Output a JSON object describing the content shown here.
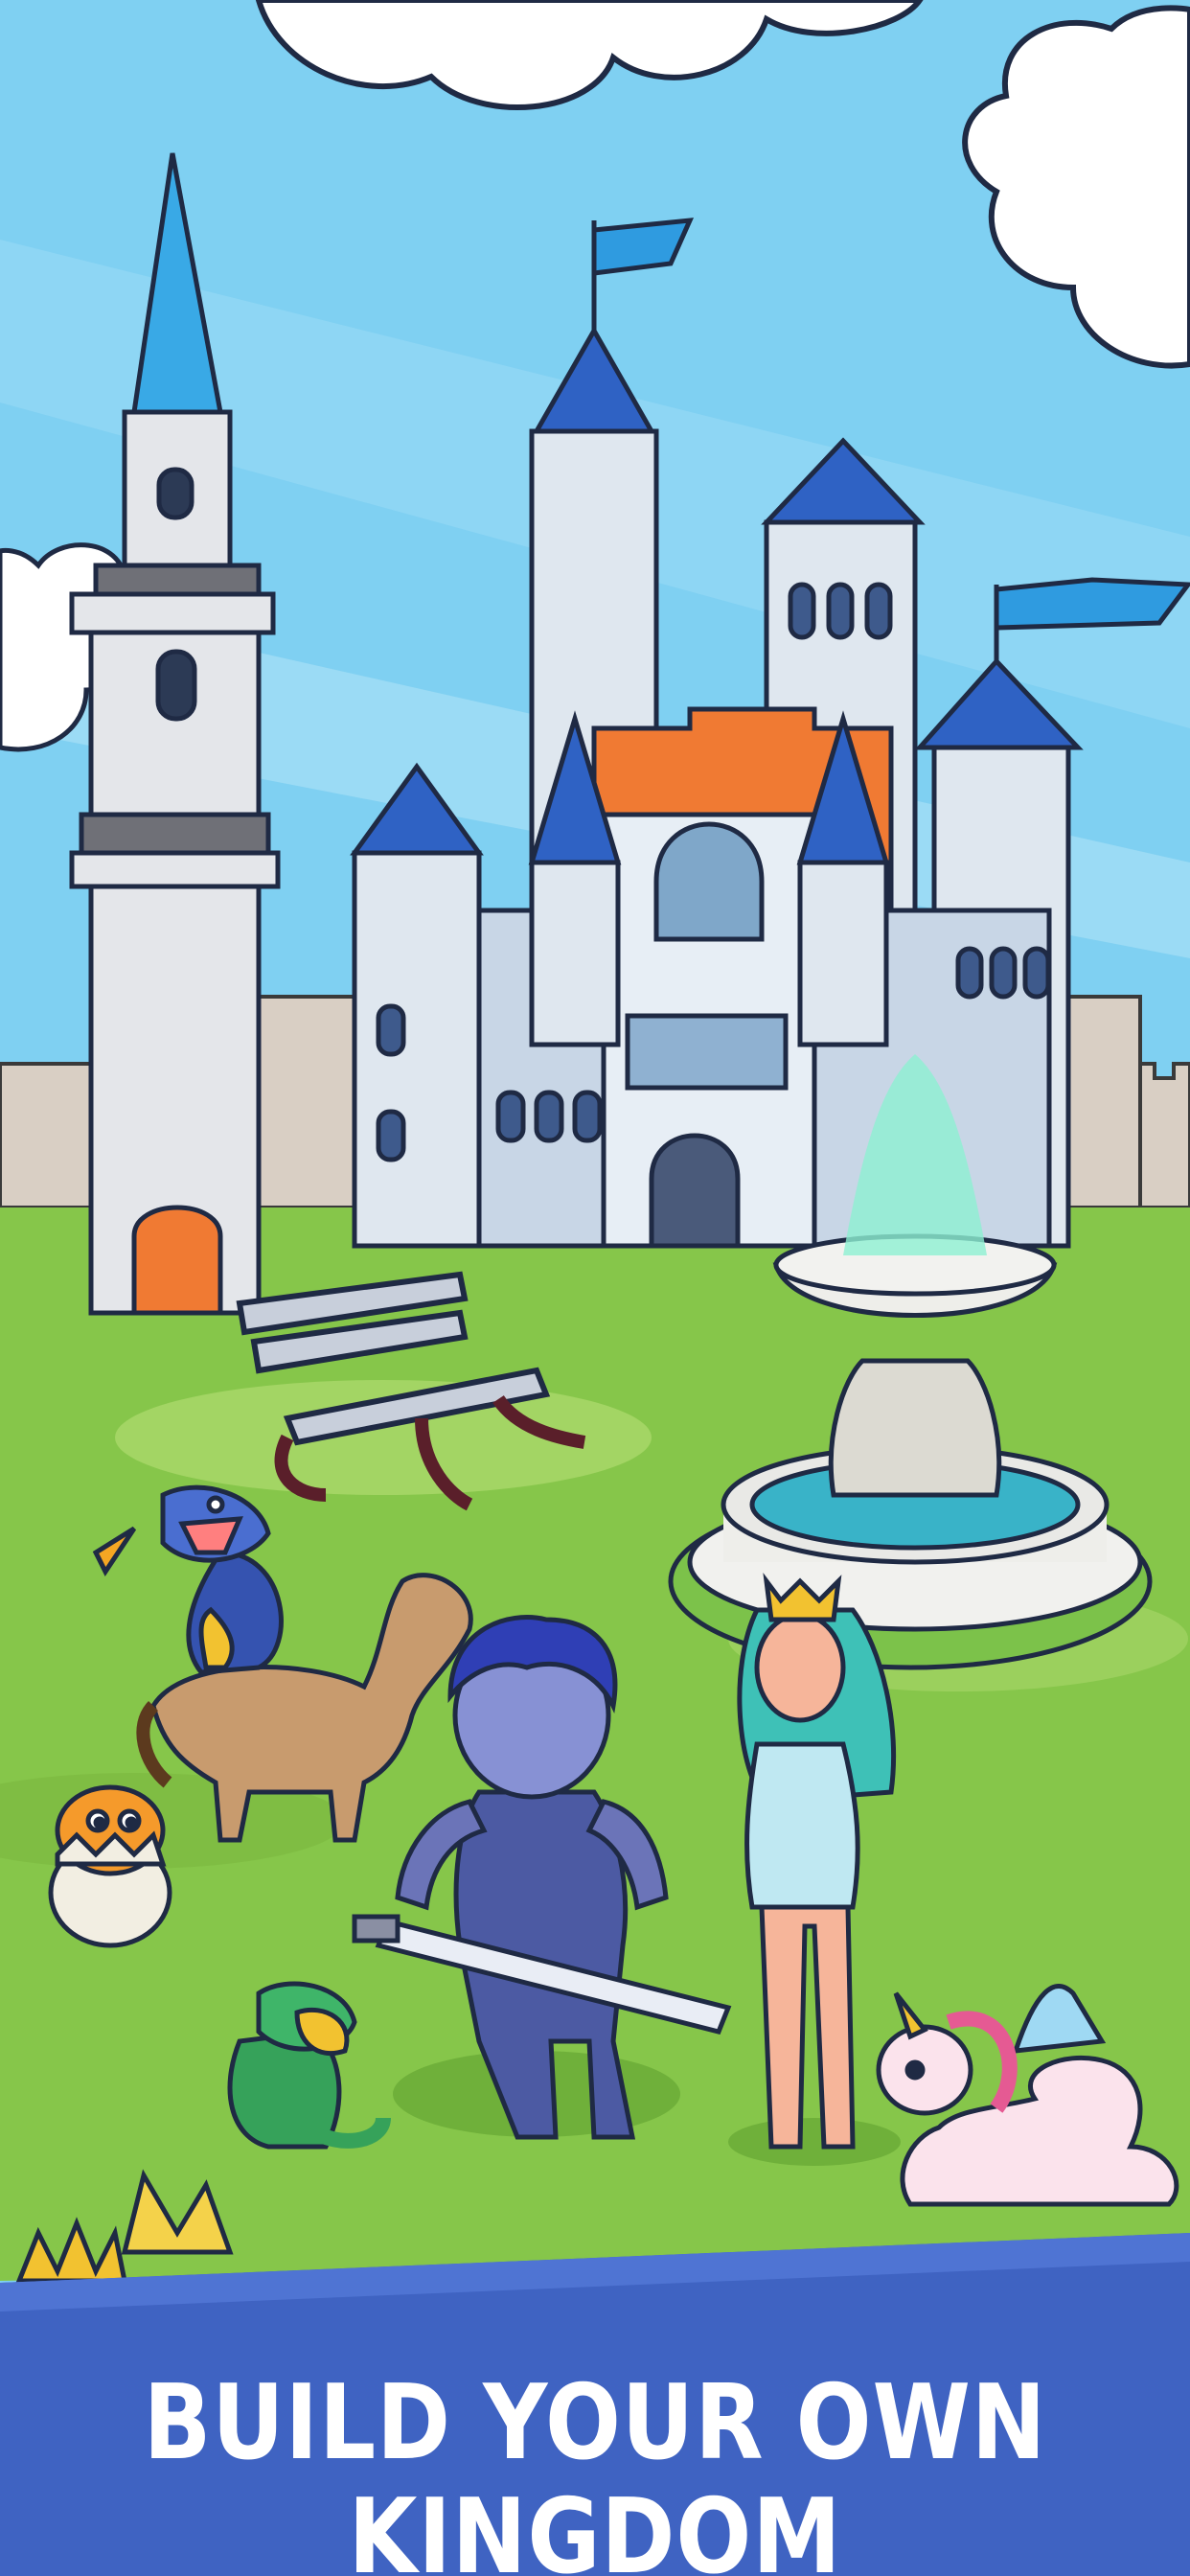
{
  "headline": "BUILD YOUR OWN KINGDOM",
  "colors": {
    "sky": "#7fd0f2",
    "grass": "#86c64a",
    "castle_stone": "#e3ebf2",
    "roof_blue": "#2f62c4",
    "banner_blue": "#3f63c2",
    "headline_text": "#ffffff"
  },
  "scene": {
    "characters": [
      "hero-with-sword",
      "queen",
      "unicorn",
      "blue-dragon",
      "horse",
      "green-dragon",
      "hatching-chick"
    ],
    "props": [
      "castle",
      "white-tower",
      "fountain",
      "park-bench",
      "flowers"
    ]
  }
}
